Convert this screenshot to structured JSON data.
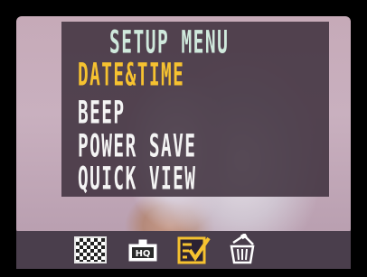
{
  "menu": {
    "title": "SETUP MENU",
    "items": [
      {
        "label": "DATE&TIME",
        "selected": true
      },
      {
        "label": "BEEP",
        "selected": false
      },
      {
        "label": "POWER SAVE",
        "selected": false
      },
      {
        "label": "QUICK VIEW",
        "selected": false
      }
    ]
  },
  "bottom_bar": {
    "icons": [
      {
        "name": "checkerboard-quality-icon"
      },
      {
        "name": "hq-frame-icon",
        "text": "HQ"
      },
      {
        "name": "setup-checklist-icon",
        "active": true
      },
      {
        "name": "trash-delete-icon"
      }
    ]
  },
  "colors": {
    "title": "#cfe9dc",
    "item": "#f4f4f4",
    "selected_item": "#f6c230",
    "panel": "#3e303c",
    "bar": "#4a3e4c",
    "active_icon": "#f6c230"
  }
}
